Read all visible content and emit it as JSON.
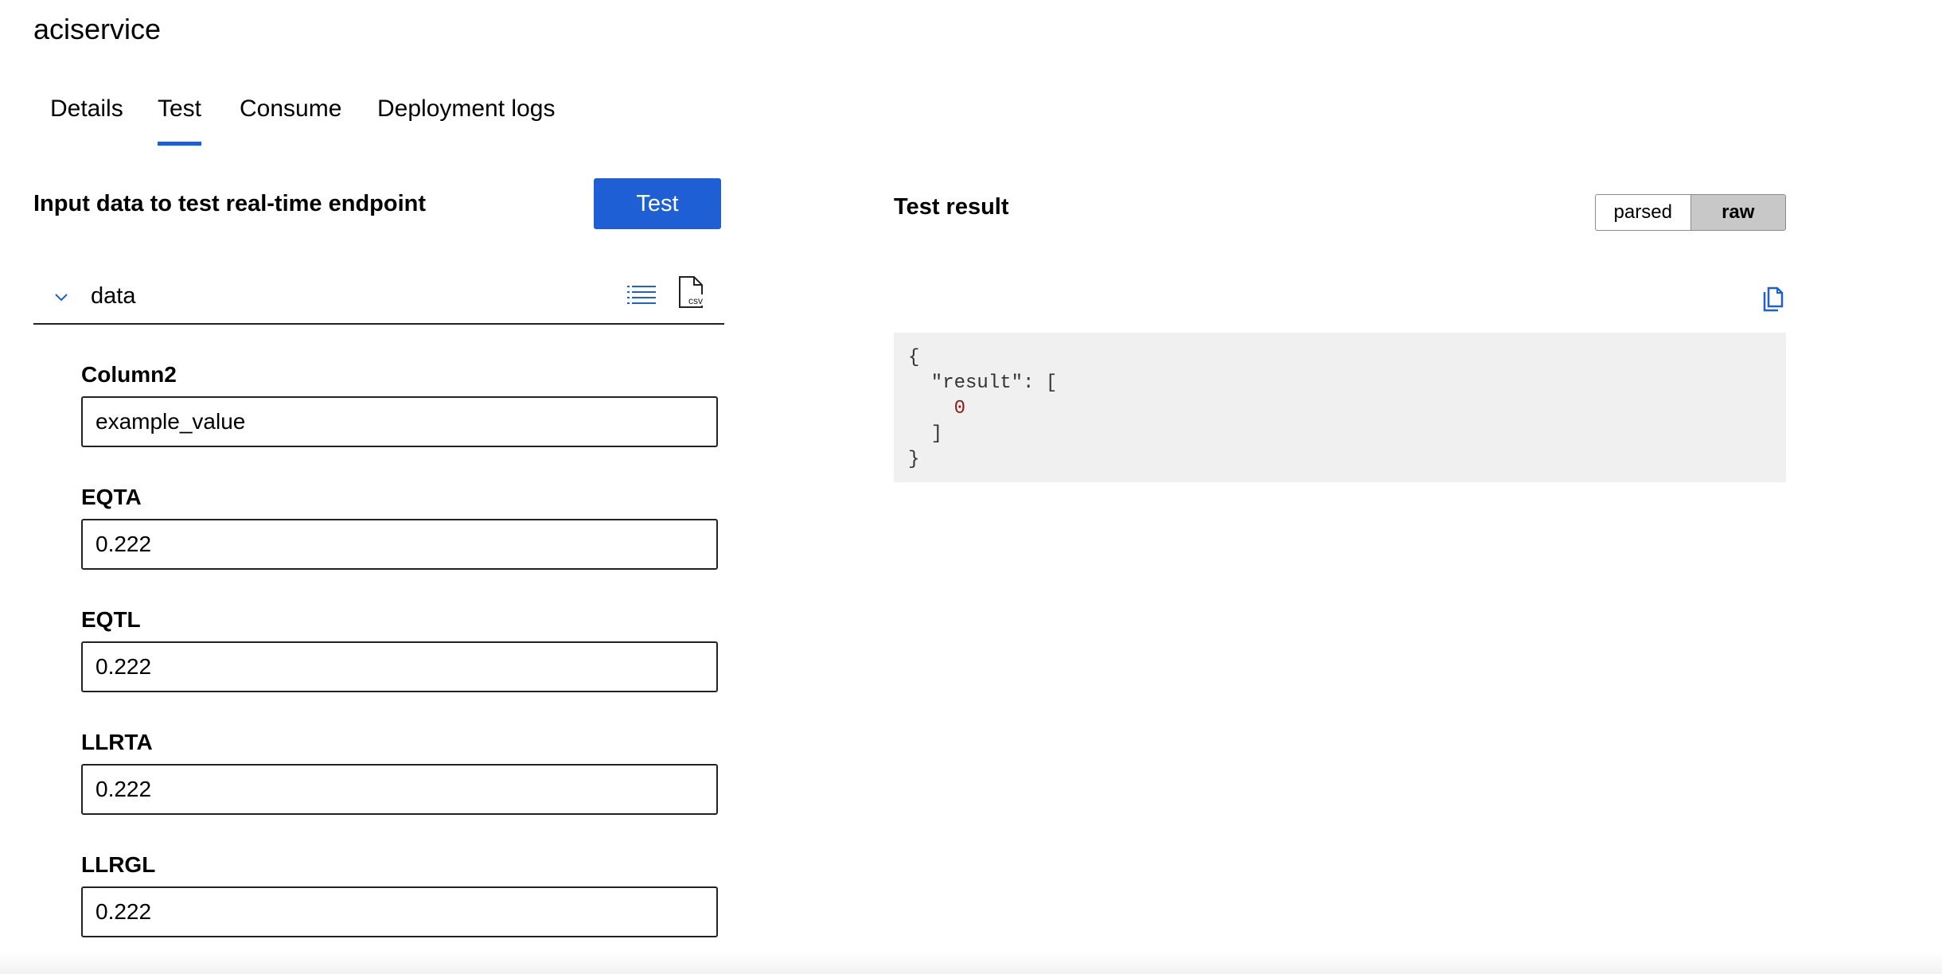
{
  "page": {
    "title": "aciservice"
  },
  "tabs": [
    {
      "label": "Details",
      "active": false
    },
    {
      "label": "Test",
      "active": true
    },
    {
      "label": "Consume",
      "active": false
    },
    {
      "label": "Deployment logs",
      "active": false
    }
  ],
  "input_panel": {
    "title": "Input data to test real-time endpoint",
    "test_button_label": "Test",
    "section_label": "data",
    "icons": [
      "chevron-down-icon",
      "list-view-icon",
      "csv-file-icon"
    ],
    "fields": [
      {
        "label": "Column2",
        "value": "example_value"
      },
      {
        "label": "EQTA",
        "value": "0.222"
      },
      {
        "label": "EQTL",
        "value": "0.222"
      },
      {
        "label": "LLRTA",
        "value": "0.222"
      },
      {
        "label": "LLRGL",
        "value": "0.222"
      }
    ]
  },
  "result_panel": {
    "title": "Test result",
    "toggle": {
      "options": [
        "parsed",
        "raw"
      ],
      "selected": "raw"
    },
    "icons": [
      "copy-icon"
    ],
    "json_lines": {
      "open_brace": "{",
      "key_line": "  \"result\": [",
      "value": "0",
      "close_bracket": "  ]",
      "close_brace": "}"
    }
  },
  "colors": {
    "accent": "#1f5fd6",
    "json_background": "#f0f0f0",
    "json_number": "#8b1a1a",
    "toggle_selected": "#c8c8c8"
  }
}
